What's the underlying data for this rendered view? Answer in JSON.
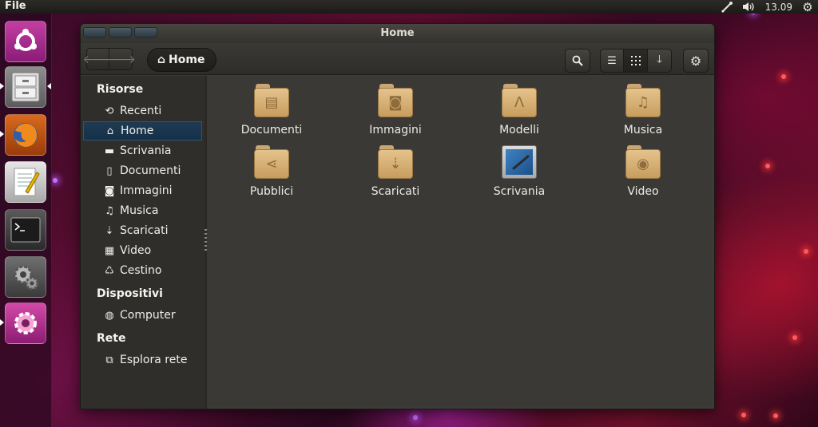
{
  "top_panel": {
    "app_menu": "File",
    "clock": "13.09"
  },
  "launcher": {
    "items": [
      "ubuntu-dash",
      "file-cabinet",
      "firefox",
      "text-editor",
      "terminal",
      "system-settings",
      "update-manager"
    ]
  },
  "window": {
    "title": "Home",
    "breadcrumb": "Home"
  },
  "sidebar": {
    "sections": [
      {
        "heading": "Risorse",
        "items": [
          "Recenti",
          "Home",
          "Scrivania",
          "Documenti",
          "Immagini",
          "Musica",
          "Scaricati",
          "Video",
          "Cestino"
        ]
      },
      {
        "heading": "Dispositivi",
        "items": [
          "Computer"
        ]
      },
      {
        "heading": "Rete",
        "items": [
          "Esplora rete"
        ]
      }
    ],
    "active": "Home"
  },
  "content": {
    "items": [
      {
        "label": "Documenti",
        "icon": "document-folder-icon"
      },
      {
        "label": "Immagini",
        "icon": "pictures-folder-icon"
      },
      {
        "label": "Modelli",
        "icon": "templates-folder-icon"
      },
      {
        "label": "Musica",
        "icon": "music-folder-icon"
      },
      {
        "label": "Pubblici",
        "icon": "public-share-folder-icon"
      },
      {
        "label": "Scaricati",
        "icon": "downloads-folder-icon"
      },
      {
        "label": "Scrivania",
        "icon": "desktop-icon"
      },
      {
        "label": "Video",
        "icon": "video-folder-icon"
      }
    ]
  }
}
